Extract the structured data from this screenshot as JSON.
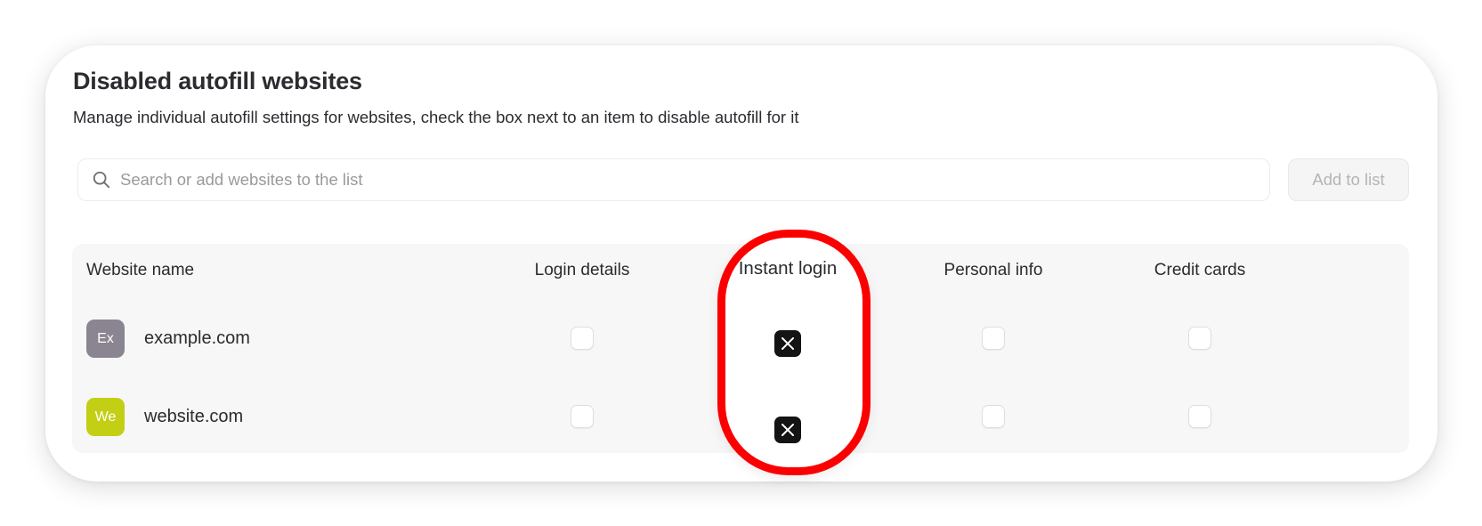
{
  "header": {
    "title": "Disabled autofill websites",
    "subtitle": "Manage individual autofill settings for websites, check the box next to an item to disable autofill for it"
  },
  "search": {
    "placeholder": "Search or add websites to the list",
    "value": "",
    "icon": "search-icon"
  },
  "add_button": {
    "label": "Add to list"
  },
  "table": {
    "columns": [
      "Website name",
      "Login details",
      "Instant login",
      "Personal info",
      "Credit cards"
    ],
    "rows": [
      {
        "avatar": "Ex",
        "avatar_color": "#8a8590",
        "name": "example.com",
        "login_details": false,
        "instant_login": true,
        "personal_info": false,
        "credit_cards": false
      },
      {
        "avatar": "We",
        "avatar_color": "#c2cf14",
        "name": "website.com",
        "login_details": false,
        "instant_login": true,
        "personal_info": false,
        "credit_cards": false
      }
    ]
  },
  "colors": {
    "highlight": "#fb0000",
    "checked": "#141414"
  }
}
